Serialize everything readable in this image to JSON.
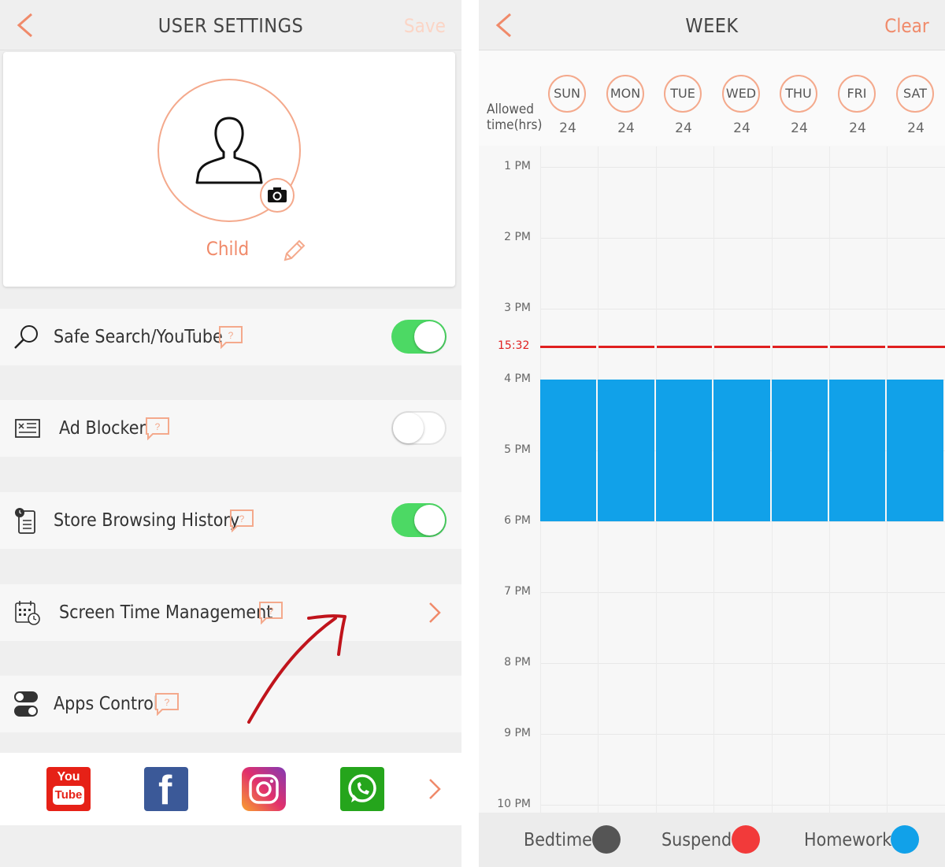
{
  "settings": {
    "title": "USER SETTINGS",
    "save_label": "Save",
    "profile": {
      "name": "Child"
    },
    "rows": {
      "safe_search": {
        "label": "Safe Search/YouTube",
        "help": "?",
        "enabled": true
      },
      "ad_blocker": {
        "label": "Ad Blocker",
        "help": "?",
        "enabled": false
      },
      "store_history": {
        "label": "Store Browsing History",
        "help": "?",
        "enabled": true
      },
      "screen_time": {
        "label": "Screen Time Management",
        "help": "?"
      },
      "apps_control": {
        "label": "Apps Control",
        "help": "?"
      }
    },
    "apps": [
      {
        "name": "youtube-icon",
        "line1": "You",
        "line2": "Tube",
        "color": "#e62117"
      },
      {
        "name": "facebook-icon",
        "glyph": "f",
        "color": "#3b5998"
      },
      {
        "name": "instagram-icon",
        "color": "#c13584"
      },
      {
        "name": "whatsapp-icon",
        "color": "#25a51c"
      }
    ]
  },
  "week": {
    "title": "WEEK",
    "clear_label": "Clear",
    "allowed_label_1": "Allowed",
    "allowed_label_2": "time(hrs)",
    "days": [
      {
        "name": "SUN",
        "hours": "24"
      },
      {
        "name": "MON",
        "hours": "24"
      },
      {
        "name": "TUE",
        "hours": "24"
      },
      {
        "name": "WED",
        "hours": "24"
      },
      {
        "name": "THU",
        "hours": "24"
      },
      {
        "name": "FRI",
        "hours": "24"
      },
      {
        "name": "SAT",
        "hours": "24"
      }
    ],
    "hours": [
      "1 PM",
      "2 PM",
      "3 PM",
      "4 PM",
      "5 PM",
      "6 PM",
      "7 PM",
      "8 PM",
      "9 PM",
      "10 PM"
    ],
    "current_time": "15:32",
    "homework_block": {
      "start": "4 PM",
      "end": "6 PM",
      "days": [
        "SUN",
        "MON",
        "TUE",
        "WED",
        "THU",
        "FRI",
        "SAT"
      ]
    },
    "legend": [
      {
        "label": "Bedtime",
        "color": "#555555"
      },
      {
        "label": "Suspend",
        "color": "#f23a3a"
      },
      {
        "label": "Homework",
        "color": "#11a1e9"
      }
    ]
  }
}
